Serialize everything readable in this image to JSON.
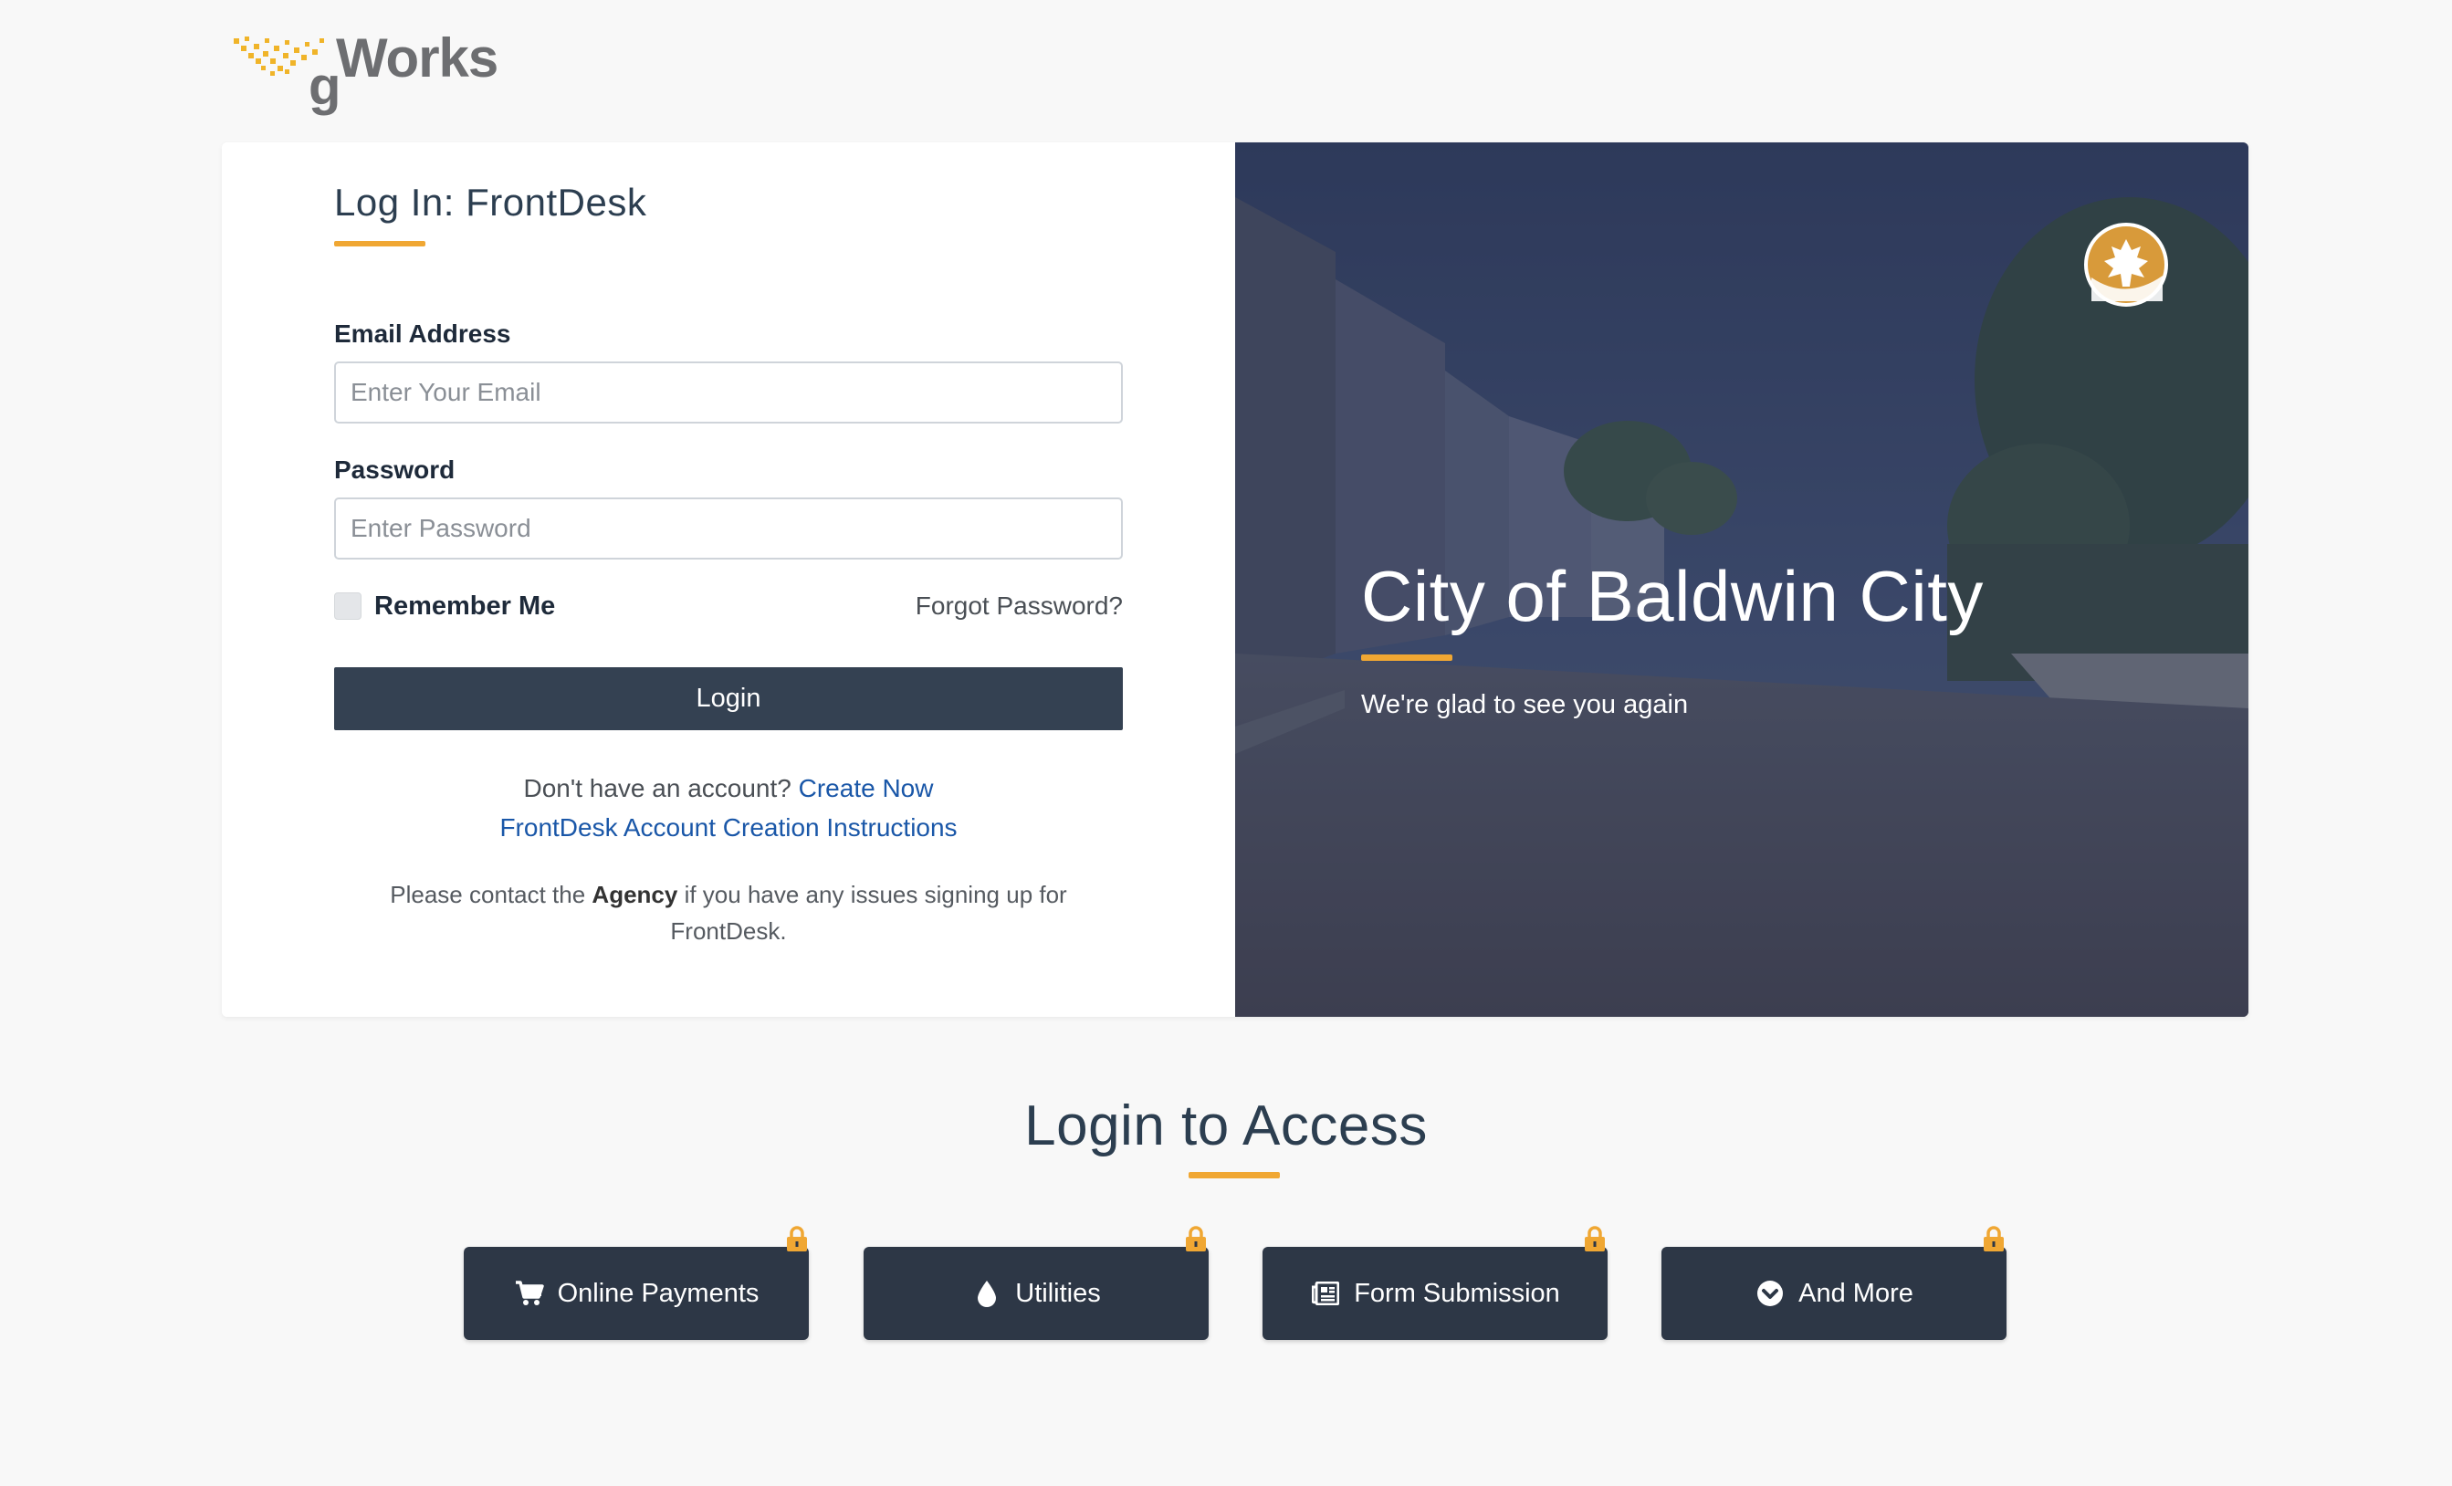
{
  "brand": {
    "logo_g": "g",
    "logo_text": "Works",
    "logo_color": "#6d6e71",
    "dots_color": "#f0b429"
  },
  "login": {
    "title": "Log In: FrontDesk",
    "email_label": "Email Address",
    "email_placeholder": "Enter Your Email",
    "email_value": "",
    "password_label": "Password",
    "password_placeholder": "Enter Password",
    "password_value": "",
    "remember_label": "Remember Me",
    "remember_checked": false,
    "forgot_label": "Forgot Password?",
    "login_button": "Login",
    "no_account_text": "Don't have an account?",
    "create_now": "Create Now",
    "instructions_link": "FrontDesk Account Creation Instructions",
    "contact_pre": "Please contact the",
    "contact_agency": "Agency",
    "contact_post": "if you have any issues signing up for",
    "contact_end": "FrontDesk."
  },
  "hero": {
    "city_title": "City of Baldwin City",
    "subtitle": "We're glad to see you again",
    "seal_icon": "maple-leaf-seal-icon"
  },
  "access": {
    "title": "Login to Access",
    "features": [
      {
        "label": "Online Payments",
        "icon": "cart-icon"
      },
      {
        "label": "Utilities",
        "icon": "water-drop-icon"
      },
      {
        "label": "Form Submission",
        "icon": "newspaper-icon"
      },
      {
        "label": "And More",
        "icon": "chevron-circle-down-icon"
      }
    ]
  },
  "colors": {
    "accent": "#f0a733",
    "button_dark": "#344152",
    "feature_bg": "#2d3746",
    "link": "#1a57a8",
    "page_bg": "#f8f8f8"
  }
}
